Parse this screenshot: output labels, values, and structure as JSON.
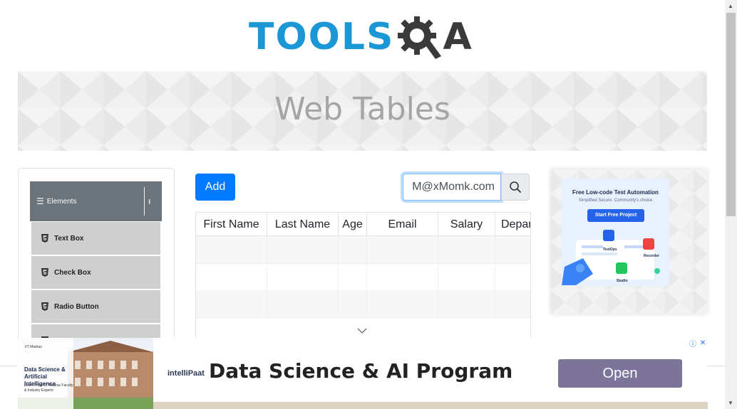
{
  "header": {
    "logo_text_left": "TOOLS",
    "logo_text_right": "A",
    "logo_icon": "gear-magnifier-icon",
    "colors": {
      "brand_blue": "#1a97d4",
      "brand_dark": "#3a3a3a"
    }
  },
  "banner": {
    "title": "Web Tables"
  },
  "sidebar": {
    "group_label": "Elements",
    "group_icon": "hamburger-icon",
    "collapse_icon": "arrow-up-icon",
    "items": [
      {
        "label": "Text Box",
        "icon": "html5-icon"
      },
      {
        "label": "Check Box",
        "icon": "html5-icon"
      },
      {
        "label": "Radio Button",
        "icon": "html5-icon"
      }
    ]
  },
  "toolbar": {
    "add_label": "Add",
    "search_value": "M@xMomk.com",
    "search_icon": "search-icon",
    "colors": {
      "primary": "#007bff"
    }
  },
  "table": {
    "columns": [
      "First Name",
      "Last Name",
      "Age",
      "Email",
      "Salary",
      "Department"
    ],
    "rows": [
      [
        "",
        "",
        "",
        "",
        "",
        ""
      ],
      [
        "",
        "",
        "",
        "",
        "",
        ""
      ],
      [
        "",
        "",
        "",
        "",
        "",
        ""
      ],
      [
        "",
        "",
        "",
        "",
        "",
        ""
      ]
    ]
  },
  "ad_right": {
    "headline": "Free Low-code Test Automation",
    "subline": "Simplified Secure. Community's choice",
    "cta": "Start Free Project",
    "labels": [
      "TestOps",
      "Recorder",
      "Studio"
    ]
  },
  "ad_bottom": {
    "thumb_badge": "IIT Madras",
    "thumb_title": "Data Science & Artificial Intelligence",
    "thumb_sub": "Learn From IIT Madras Faculty & Industry Experts",
    "brand": "intelliPaat",
    "headline": "Data Science & AI Program",
    "cta": "Open"
  }
}
